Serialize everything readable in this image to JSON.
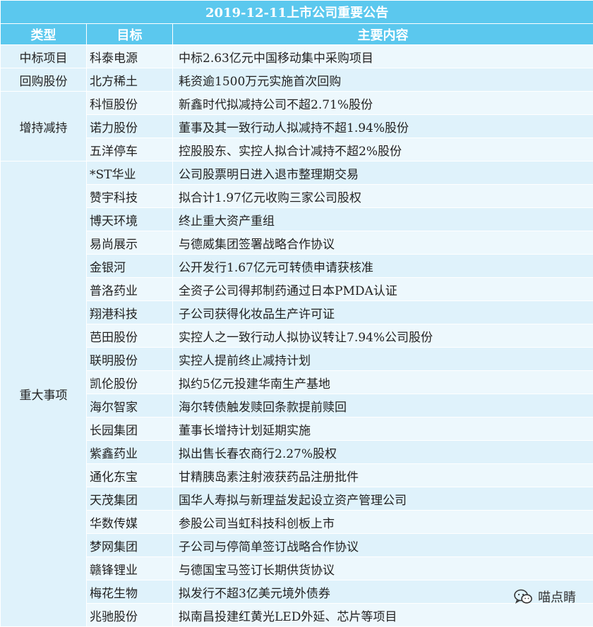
{
  "title": "2019-12-11上市公司重要公告",
  "headers": {
    "type": "类型",
    "target": "目标",
    "content": "主要内容"
  },
  "groups": [
    {
      "type": "中标项目",
      "rows": [
        {
          "target": "科泰电源",
          "content": "中标2.63亿元中国移动集中采购项目"
        }
      ]
    },
    {
      "type": "回购股份",
      "rows": [
        {
          "target": "北方稀土",
          "content": "耗资逾1500万元实施首次回购"
        }
      ]
    },
    {
      "type": "增持减持",
      "rows": [
        {
          "target": "科恒股份",
          "content": "新鑫时代拟减持公司不超2.71%股份"
        },
        {
          "target": "诺力股份",
          "content": "董事及其一致行动人拟减持不超1.94%股份"
        },
        {
          "target": "五洋停车",
          "content": "控股股东、实控人拟合计减持不超2%股份"
        }
      ]
    },
    {
      "type": "重大事项",
      "rows": [
        {
          "target": "*ST华业",
          "content": "公司股票明日进入退市整理期交易"
        },
        {
          "target": "赞宇科技",
          "content": "拟合计1.97亿元收购三家公司股权"
        },
        {
          "target": "博天环境",
          "content": "终止重大资产重组"
        },
        {
          "target": "易尚展示",
          "content": "与德威集团签署战略合作协议"
        },
        {
          "target": "金银河",
          "content": "公开发行1.67亿元可转债申请获核准"
        },
        {
          "target": "普洛药业",
          "content": "全资子公司得邦制药通过日本PMDA认证"
        },
        {
          "target": "翔港科技",
          "content": "子公司获得化妆品生产许可证"
        },
        {
          "target": "芭田股份",
          "content": "实控人之一致行动人拟协议转让7.94%公司股份"
        },
        {
          "target": "联明股份",
          "content": "实控人提前终止减持计划"
        },
        {
          "target": "凯伦股份",
          "content": "拟约5亿元投建华南生产基地"
        },
        {
          "target": "海尔智家",
          "content": "海尔转债触发赎回条款提前赎回"
        },
        {
          "target": "长园集团",
          "content": "董事长增持计划延期实施"
        },
        {
          "target": "紫鑫药业",
          "content": "拟出售长春农商行2.27%股权"
        },
        {
          "target": "通化东宝",
          "content": "甘精胰岛素注射液获药品注册批件"
        },
        {
          "target": "天茂集团",
          "content": "国华人寿拟与新理益发起设立资产管理公司"
        },
        {
          "target": "华数传媒",
          "content": "参股公司当虹科技科创板上市"
        },
        {
          "target": "梦网集团",
          "content": "子公司与停简单签订战略合作协议"
        },
        {
          "target": "赣锋锂业",
          "content": "与德国宝马签订长期供货协议"
        },
        {
          "target": "梅花生物",
          "content": "拟发行不超3亿美元境外债券"
        },
        {
          "target": "兆驰股份",
          "content": "拟南昌投建红黄光LED外延、芯片等项目"
        }
      ]
    }
  ],
  "watermark": {
    "text": "喵点睛",
    "icon": "wechat-icon"
  }
}
